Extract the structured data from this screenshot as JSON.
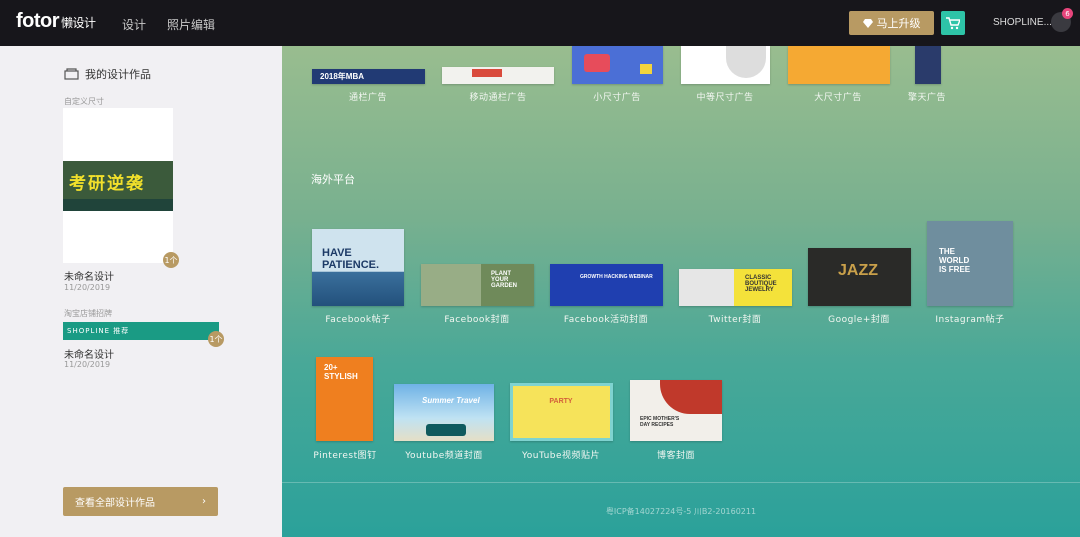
{
  "header": {
    "logo": "fotor",
    "logo_sub": "懒设计",
    "nav": [
      "设计",
      "照片编辑"
    ],
    "upgrade_label": "马上升级",
    "username": "SHOPLINE...",
    "badge_count": "6"
  },
  "sidebar": {
    "title": "我的设计作品",
    "groups": [
      {
        "section": "自定义尺寸",
        "name": "未命名设计",
        "date": "11/20/2019",
        "count": "1个",
        "art_text": "考研逆袭"
      },
      {
        "section": "淘宝店铺招牌",
        "name": "未命名设计",
        "date": "11/20/2019",
        "count": "1个",
        "art_text": "SHOPLINE 推荐"
      }
    ],
    "view_all": "查看全部设计作品"
  },
  "main": {
    "top_row": [
      "通栏广告",
      "移动通栏广告",
      "小尺寸广告",
      "中等尺寸广告",
      "大尺寸广告",
      "擎天广告"
    ],
    "top_thumb_text": {
      "tongl": "2018年MBA"
    },
    "section_title": "海外平台",
    "row1": [
      "Facebook帖子",
      "Facebook封面",
      "Facebook活动封面",
      "Twitter封面",
      "Google+封面",
      "Instagram帖子"
    ],
    "row1_text": [
      "HAVE PATIENCE.",
      "PLANT YOUR GARDEN",
      "GROWTH HACKING WEBINAR",
      "CLASSIC BOUTIQUE JEWELRY",
      "JAZZ",
      "THE WORLD IS FREE"
    ],
    "row2": [
      "Pinterest图钉",
      "Youtube频道封面",
      "YouTube视频贴片",
      "博客封面"
    ],
    "row2_text": [
      "20+ STYLISH",
      "Summer Travel",
      "PARTY",
      "EPIC MOTHER'S DAY RECIPES"
    ],
    "icp": "粤ICP备14027224号-5 川B2-20160211"
  }
}
